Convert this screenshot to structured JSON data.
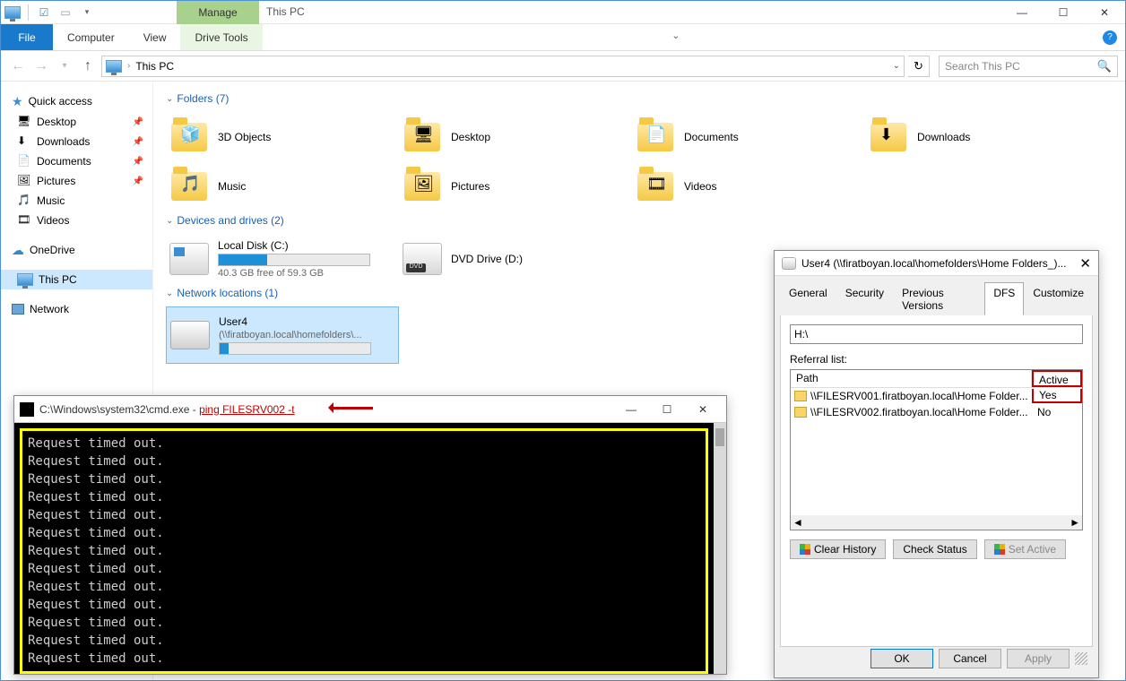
{
  "window": {
    "title": "This PC",
    "ribbon_context": "Manage",
    "tabs": {
      "file": "File",
      "computer": "Computer",
      "view": "View",
      "drivetools": "Drive Tools"
    }
  },
  "address": {
    "path": "This PC",
    "search_placeholder": "Search This PC"
  },
  "nav": {
    "quick_access": "Quick access",
    "items_qa": [
      "Desktop",
      "Downloads",
      "Documents",
      "Pictures",
      "Music",
      "Videos"
    ],
    "onedrive": "OneDrive",
    "thispc": "This PC",
    "network": "Network"
  },
  "sections": {
    "folders": "Folders (7)",
    "drives": "Devices and drives (2)",
    "netloc": "Network locations (1)"
  },
  "folders": [
    "3D Objects",
    "Desktop",
    "Documents",
    "Downloads",
    "Music",
    "Pictures",
    "Videos"
  ],
  "drives": {
    "local": {
      "name": "Local Disk (C:)",
      "free": "40.3 GB free of 59.3 GB",
      "fill_pct": 32
    },
    "dvd": {
      "name": "DVD Drive (D:)"
    }
  },
  "netloc": {
    "name": "User4",
    "path": "(\\\\firatboyan.local\\homefolders\\..."
  },
  "cmd": {
    "title_pre": "C:\\Windows\\system32\\cmd.exe - ",
    "title_hl": "ping  FILESRV002 -t",
    "line": "Request timed out.",
    "repeat": 13
  },
  "dlg": {
    "title": "User4 (\\\\firatboyan.local\\homefolders\\Home Folders_)...",
    "tabs": [
      "General",
      "Security",
      "Previous Versions",
      "DFS",
      "Customize"
    ],
    "active_tab": 3,
    "path": "H:\\",
    "ref_label": "Referral list:",
    "cols": {
      "path": "Path",
      "active": "Active"
    },
    "rows": [
      {
        "path": "\\\\FILESRV001.firatboyan.local\\Home Folder...",
        "active": "Yes",
        "hl": true
      },
      {
        "path": "\\\\FILESRV002.firatboyan.local\\Home Folder...",
        "active": "No",
        "hl": false
      }
    ],
    "btns": {
      "clear": "Clear History",
      "check": "Check Status",
      "set": "Set Active"
    },
    "foot": {
      "ok": "OK",
      "cancel": "Cancel",
      "apply": "Apply"
    }
  }
}
